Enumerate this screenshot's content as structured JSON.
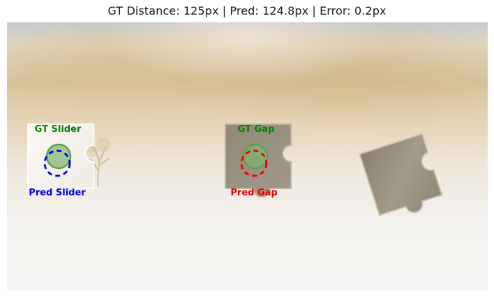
{
  "figure": {
    "title": "GT Distance: 125px | Pred: 124.8px | Error: 0.2px"
  },
  "annotations": {
    "gt_slider": {
      "label": "GT Slider",
      "color": "#008000"
    },
    "pred_slider": {
      "label": "Pred Slider",
      "color": "#0000e6"
    },
    "gt_gap": {
      "label": "GT Gap",
      "color": "#008000"
    },
    "pred_gap": {
      "label": "Pred Gap",
      "color": "#e60000"
    }
  },
  "colors": {
    "gt_fill": "#7fb56f",
    "gt_stroke": "#5fa050",
    "pred_slider_stroke": "#0000e6",
    "pred_gap_stroke": "#e60000",
    "sky_top": "#b9c8d6",
    "sand": "#dcc7a0",
    "fog": "#f4f2ef",
    "puzzle_piece": "#908773"
  }
}
